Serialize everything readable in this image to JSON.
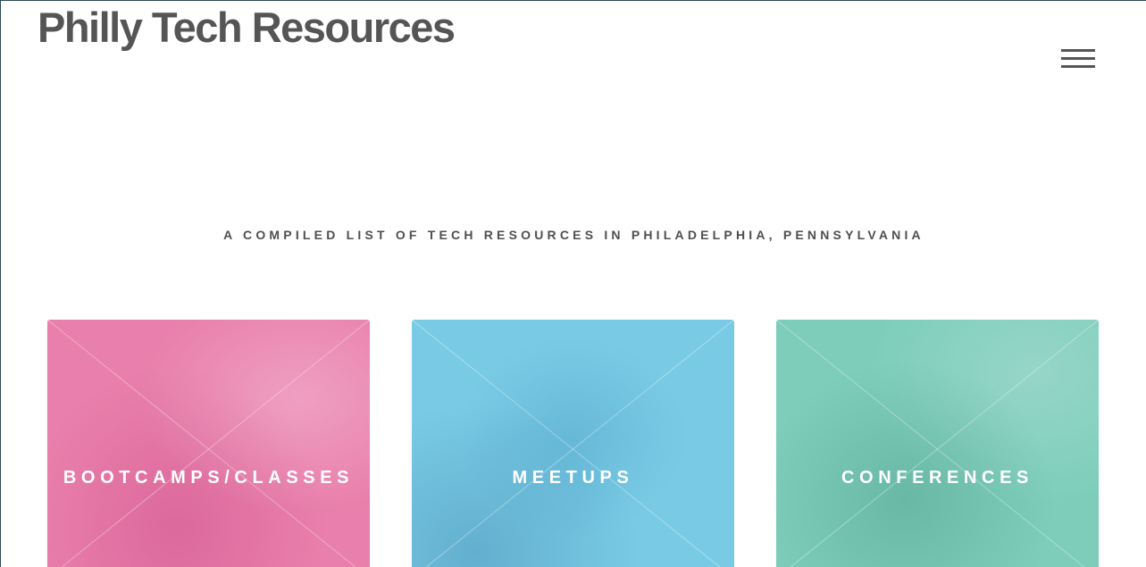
{
  "header": {
    "site_title": "Philly Tech Resources",
    "menu_icon": "hamburger-menu-icon"
  },
  "main": {
    "tagline": "A COMPILED LIST OF TECH RESOURCES IN PHILADELPHIA, PENNSYLVANIA",
    "cards": [
      {
        "label": "BOOTCAMPS/CLASSES",
        "color": "#e97fac"
      },
      {
        "label": "MEETUPS",
        "color": "#79cbe5"
      },
      {
        "label": "CONFERENCES",
        "color": "#7ecdbb"
      }
    ]
  }
}
